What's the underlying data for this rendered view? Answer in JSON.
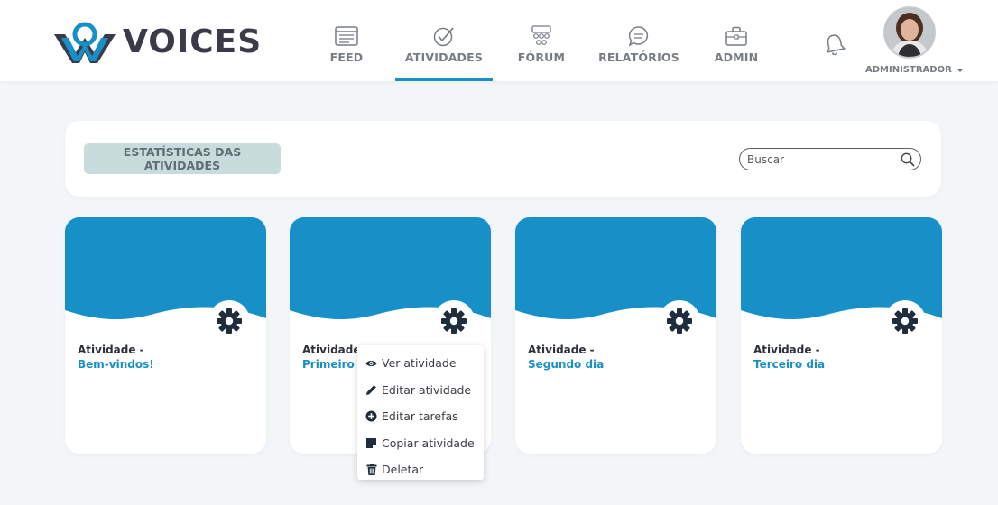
{
  "app": {
    "brand": "VOICES",
    "colors": {
      "accent": "#1790c8",
      "text_dark": "#3a3a48",
      "nav_text": "#777d85",
      "stats_bg": "#c9dcdc"
    }
  },
  "nav": {
    "items": [
      {
        "label": "FEED",
        "icon": "feed-icon",
        "active": false
      },
      {
        "label": "ATIVIDADES",
        "icon": "check-circle-icon",
        "active": true
      },
      {
        "label": "FÓRUM",
        "icon": "people-group-icon",
        "active": false
      },
      {
        "label": "RELATÓRIOS",
        "icon": "chat-bubble-icon",
        "active": false
      },
      {
        "label": "ADMIN",
        "icon": "briefcase-icon",
        "active": false
      }
    ]
  },
  "user": {
    "role": "ADMINISTRADOR"
  },
  "toolbar": {
    "stats_label": "ESTATÍSTICAS DAS ATIVIDADES",
    "search_placeholder": "Buscar"
  },
  "cards": [
    {
      "label": "Atividade -",
      "title": "Bem-vindos!"
    },
    {
      "label": "Atividade -",
      "title": "Primeiro Dia"
    },
    {
      "label": "Atividade -",
      "title": "Segundo dia"
    },
    {
      "label": "Atividade -",
      "title": "Terceiro dia"
    }
  ],
  "context_menu": {
    "items": [
      {
        "label": "Ver atividade",
        "icon": "eye-icon"
      },
      {
        "label": "Editar atividade",
        "icon": "pencil-icon"
      },
      {
        "label": "Editar tarefas",
        "icon": "plus-circle-icon"
      },
      {
        "label": "Copiar atividade",
        "icon": "copy-icon"
      },
      {
        "label": "Deletar",
        "icon": "trash-icon"
      }
    ]
  }
}
